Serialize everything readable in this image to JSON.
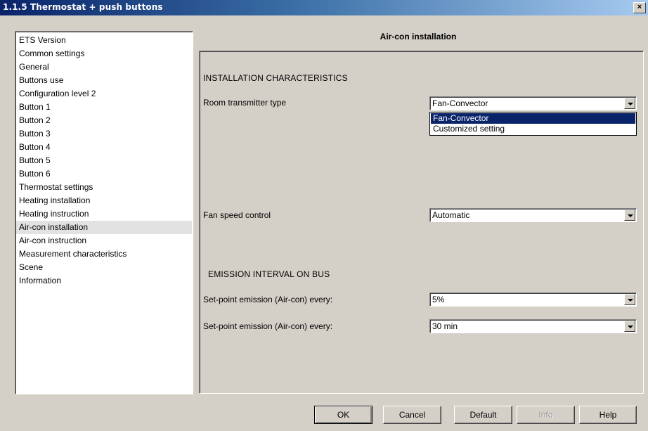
{
  "window": {
    "title": "1.1.5 Thermostat + push buttons",
    "close_glyph": "×"
  },
  "sidebar": {
    "items": [
      "ETS Version",
      "Common settings",
      "General",
      "Buttons use",
      "Configuration level 2",
      "Button 1",
      "Button 2",
      "Button 3",
      "Button 4",
      "Button 5",
      "Button 6",
      "Thermostat settings",
      "Heating installation",
      "Heating instruction",
      "Air-con installation",
      "Air-con instruction",
      "Measurement characteristics",
      "Scene",
      "Information"
    ],
    "selected": "Air-con installation"
  },
  "main": {
    "title": "Air-con installation",
    "section1": "INSTALLATION CHARACTERISTICS",
    "room_transmitter": {
      "label": "Room transmitter type",
      "value": "Fan-Convector",
      "options": [
        "Fan-Convector",
        "Customized setting"
      ],
      "highlighted": "Fan-Convector"
    },
    "fan_speed": {
      "label": "Fan speed control",
      "value": "Automatic"
    },
    "section2": "EMISSION INTERVAL ON BUS",
    "setpoint1": {
      "label": "Set-point emission (Air-con) every:",
      "value": "5%"
    },
    "setpoint2": {
      "label": "Set-point emission (Air-con) every:",
      "value": "30 min"
    }
  },
  "buttons": {
    "ok": "OK",
    "cancel": "Cancel",
    "default": "Default",
    "info": "Info",
    "help": "Help"
  },
  "colors": {
    "title_start": "#0a246a",
    "title_end": "#a6caf0",
    "face": "#d4d0c8",
    "highlight": "#0a246a"
  }
}
